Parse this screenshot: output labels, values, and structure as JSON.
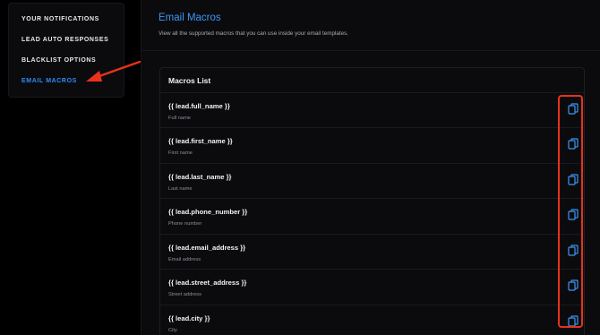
{
  "sidebar": {
    "items": [
      {
        "label": "YOUR NOTIFICATIONS",
        "active": false
      },
      {
        "label": "LEAD AUTO RESPONSES",
        "active": false
      },
      {
        "label": "BLACKLIST OPTIONS",
        "active": false
      },
      {
        "label": "EMAIL MACROS",
        "active": true
      }
    ]
  },
  "main": {
    "title": "Email Macros",
    "description": "View all the supported macros that you can use inside your email templates."
  },
  "macros_card": {
    "title": "Macros List",
    "rows": [
      {
        "code": "{{ lead.full_name }}",
        "description": "Full name"
      },
      {
        "code": "{{ lead.first_name }}",
        "description": "First name"
      },
      {
        "code": "{{ lead.last_name }}",
        "description": "Last name"
      },
      {
        "code": "{{ lead.phone_number }}",
        "description": "Phone number"
      },
      {
        "code": "{{ lead.email_address }}",
        "description": "Email address"
      },
      {
        "code": "{{ lead.street_address }}",
        "description": "Street address"
      },
      {
        "code": "{{ lead.city }}",
        "description": "City"
      }
    ]
  },
  "icons": {
    "copy": "copy-icon",
    "annotation_arrow": "arrow-icon"
  },
  "colors": {
    "accent": "#3d96f5",
    "annotation": "#e8321c",
    "background": "#000000",
    "panel": "#0b0b0e"
  }
}
